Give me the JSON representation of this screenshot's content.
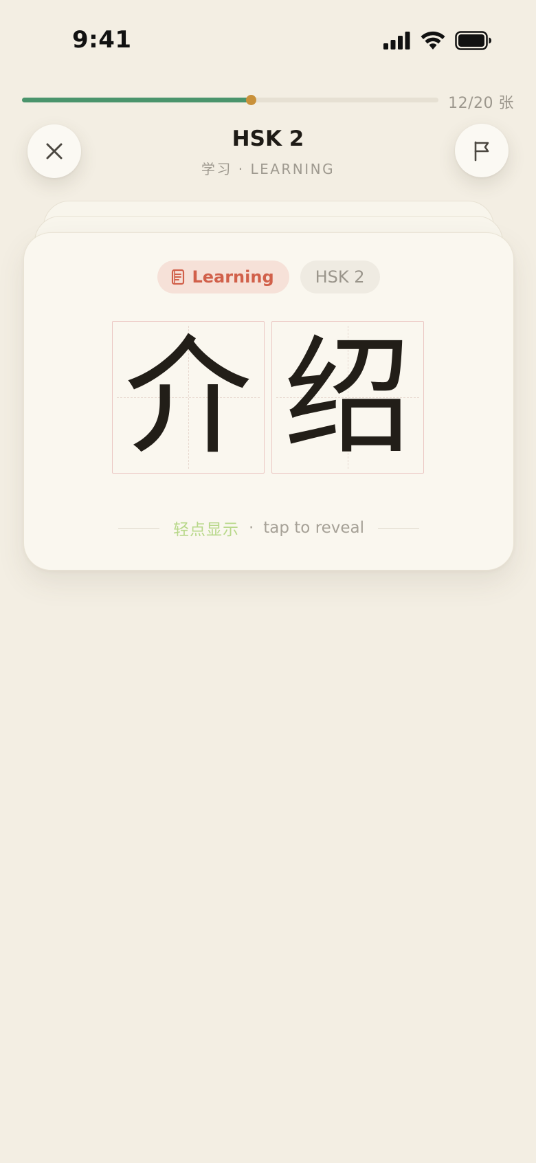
{
  "status_bar": {
    "time": "9:41"
  },
  "progress": {
    "current": 12,
    "total": 20,
    "label": "12/20 张",
    "fill_fraction": 0.55,
    "colors": {
      "fill": "#4a946c",
      "knob": "#c9913a"
    }
  },
  "header": {
    "title": "HSK 2",
    "subtitle": "学习 · LEARNING",
    "close_icon": "close-icon",
    "flag_icon": "flag-icon"
  },
  "card": {
    "chips": {
      "learning": "Learning",
      "learning_icon": "notebook-icon",
      "level": "HSK 2"
    },
    "characters": [
      "介",
      "绍"
    ],
    "reveal": {
      "chinese": "轻点显示",
      "separator": "·",
      "english": "tap to reveal"
    }
  },
  "colors": {
    "background": "#f3eee3",
    "card": "#faf7ef",
    "accent_red": "#d1604a",
    "hint_green": "#b8d88a"
  }
}
